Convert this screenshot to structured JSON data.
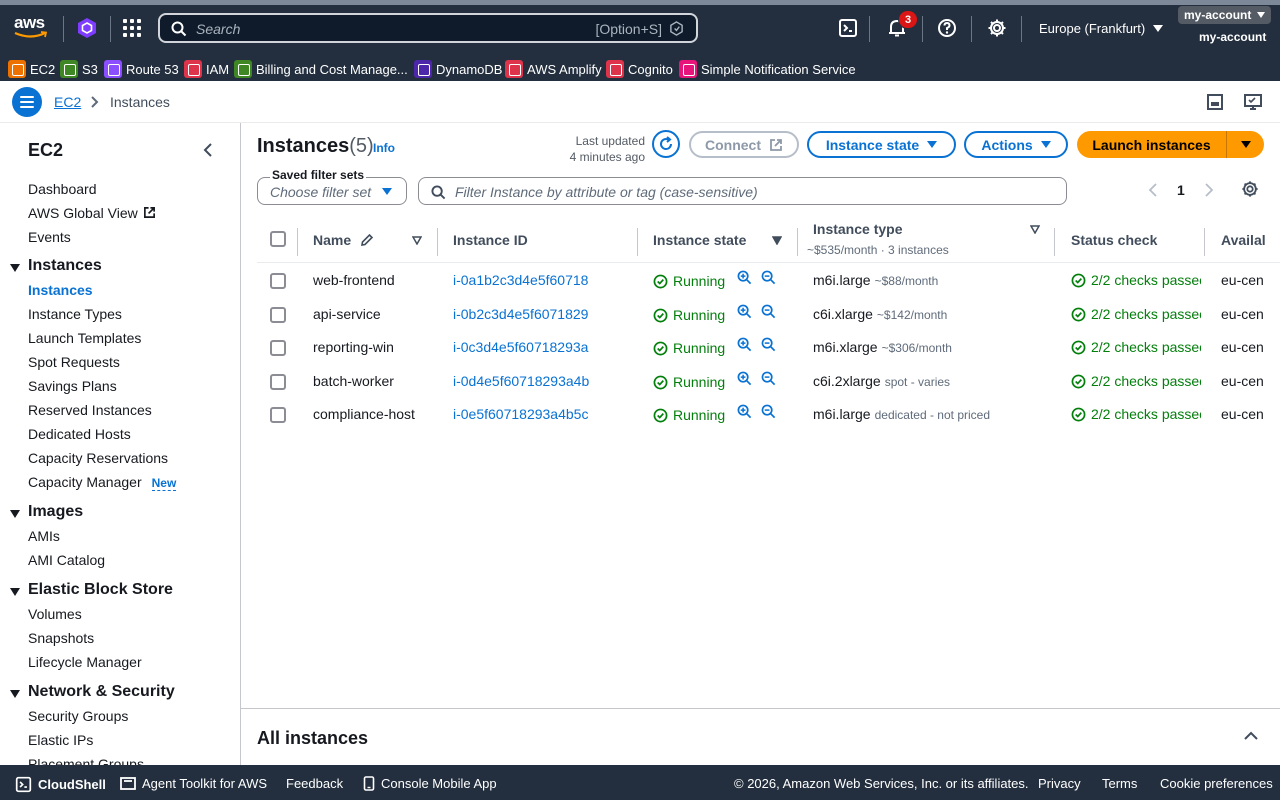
{
  "topbar": {
    "logo_text": "aws",
    "search_placeholder": "Search",
    "search_shortcut": "[Option+S]",
    "notification_count": "3",
    "region": "Europe (Frankfurt)",
    "account_tag": "my-account",
    "account_name": "my-account"
  },
  "favorites": [
    {
      "label": "EC2",
      "color": "#ed7100"
    },
    {
      "label": "S3",
      "color": "#3f8624"
    },
    {
      "label": "Route 53",
      "color": "#8c4fff"
    },
    {
      "label": "IAM",
      "color": "#dd344c"
    },
    {
      "label": "Billing and Cost Manage...",
      "color": "#3f8624"
    },
    {
      "label": "DynamoDB",
      "color": "#4d27aa"
    },
    {
      "label": "AWS Amplify",
      "color": "#dd344c"
    },
    {
      "label": "Cognito",
      "color": "#dd344c"
    },
    {
      "label": "Simple Notification Service",
      "color": "#e7157b"
    }
  ],
  "breadcrumb": {
    "root": "EC2",
    "current": "Instances"
  },
  "sidebar": {
    "title": "EC2",
    "top_items": [
      "Dashboard",
      "AWS Global View",
      "Events"
    ],
    "sections": [
      {
        "title": "Instances",
        "items": [
          "Instances",
          "Instance Types",
          "Launch Templates",
          "Spot Requests",
          "Savings Plans",
          "Reserved Instances",
          "Dedicated Hosts",
          "Capacity Reservations",
          "Capacity Manager"
        ]
      },
      {
        "title": "Images",
        "items": [
          "AMIs",
          "AMI Catalog"
        ]
      },
      {
        "title": "Elastic Block Store",
        "items": [
          "Volumes",
          "Snapshots",
          "Lifecycle Manager"
        ]
      },
      {
        "title": "Network & Security",
        "items": [
          "Security Groups",
          "Elastic IPs",
          "Placement Groups"
        ]
      }
    ],
    "new_badge": "New"
  },
  "header": {
    "title": "Instances",
    "count": "(5)",
    "info": "Info",
    "last_updated_label": "Last updated",
    "last_updated_value": "4 minutes ago",
    "connect": "Connect",
    "instance_state": "Instance state",
    "actions": "Actions",
    "launch": "Launch instances"
  },
  "filters": {
    "saved_label": "Saved filter sets",
    "saved_placeholder": "Choose filter set",
    "filter_placeholder": "Filter Instance by attribute or tag (case-sensitive)",
    "page": "1"
  },
  "table": {
    "columns": {
      "name": "Name",
      "id": "Instance ID",
      "state": "Instance state",
      "type": "Instance type",
      "type_sub": "~$535/month · 3 instances",
      "status": "Status check",
      "az": "Availal"
    },
    "rows": [
      {
        "name": "web-frontend",
        "id": "i-0a1b2c3d4e5f60718",
        "state": "Running",
        "type": "m6i.large",
        "cost": "~$88/month",
        "status": "2/2 checks passec",
        "az": "eu-cen"
      },
      {
        "name": "api-service",
        "id": "i-0b2c3d4e5f6071829",
        "state": "Running",
        "type": "c6i.xlarge",
        "cost": "~$142/month",
        "status": "2/2 checks passec",
        "az": "eu-cen"
      },
      {
        "name": "reporting-win",
        "id": "i-0c3d4e5f60718293a",
        "state": "Running",
        "type": "m6i.xlarge",
        "cost": "~$306/month",
        "status": "2/2 checks passec",
        "az": "eu-cen"
      },
      {
        "name": "batch-worker",
        "id": "i-0d4e5f60718293a4b",
        "state": "Running",
        "type": "c6i.2xlarge",
        "cost": "spot - varies",
        "status": "2/2 checks passec",
        "az": "eu-cen"
      },
      {
        "name": "compliance-host",
        "id": "i-0e5f60718293a4b5c",
        "state": "Running",
        "type": "m6i.large",
        "cost": "dedicated - not priced",
        "status": "2/2 checks passec",
        "az": "eu-cen"
      }
    ]
  },
  "bottom_panel": {
    "title": "All instances"
  },
  "footer": {
    "cloudshell": "CloudShell",
    "agent": "Agent Toolkit for AWS",
    "feedback": "Feedback",
    "mobile": "Console Mobile App",
    "copyright": "© 2026, Amazon Web Services, Inc. or its affiliates.",
    "privacy": "Privacy",
    "terms": "Terms",
    "cookies": "Cookie preferences"
  }
}
